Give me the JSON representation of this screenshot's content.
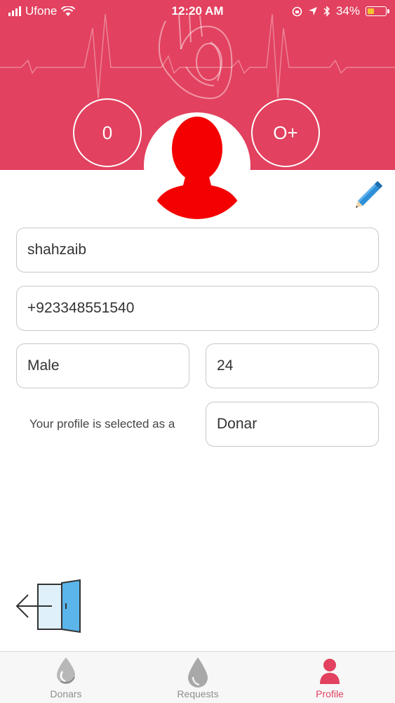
{
  "status_bar": {
    "carrier": "Ufone",
    "time": "12:20 AM",
    "battery": "34%"
  },
  "header": {
    "left_stat": "0",
    "blood_group": "O+"
  },
  "profile": {
    "name": "shahzaib",
    "phone": "+923348551540",
    "gender": "Male",
    "age": "24",
    "role_label": "Your profile is selected as a",
    "role": "Donar"
  },
  "tabs": [
    {
      "label": "Donars",
      "icon": "blood-drop-icon",
      "active": false
    },
    {
      "label": "Requests",
      "icon": "blood-drop-icon",
      "active": false
    },
    {
      "label": "Profile",
      "icon": "person-icon",
      "active": true
    }
  ],
  "colors": {
    "brand": "#e2415f",
    "avatar": "#f40000",
    "pencil": "#2f8fd8"
  }
}
